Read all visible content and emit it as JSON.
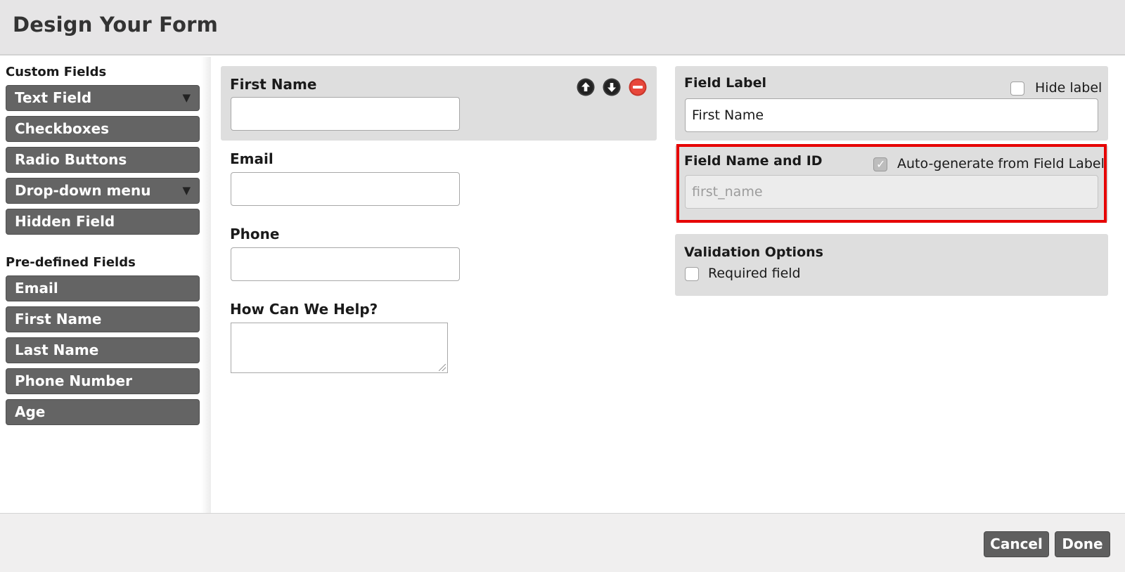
{
  "window": {
    "title": "Design Your Form"
  },
  "sidebar": {
    "custom_title": "Custom Fields",
    "custom_items": [
      {
        "label": "Text Field",
        "has_dropdown": true
      },
      {
        "label": "Checkboxes",
        "has_dropdown": false
      },
      {
        "label": "Radio Buttons",
        "has_dropdown": false
      },
      {
        "label": "Drop-down menu",
        "has_dropdown": true
      },
      {
        "label": "Hidden Field",
        "has_dropdown": false
      }
    ],
    "predefined_title": "Pre-defined Fields",
    "predefined_items": [
      {
        "label": "Email"
      },
      {
        "label": "First Name"
      },
      {
        "label": "Last Name"
      },
      {
        "label": "Phone Number"
      },
      {
        "label": "Age"
      }
    ],
    "caret": "▼"
  },
  "form": {
    "fields": [
      {
        "label": "First Name",
        "type": "text",
        "selected": true
      },
      {
        "label": "Email",
        "type": "text",
        "selected": false
      },
      {
        "label": "Phone",
        "type": "text",
        "selected": false
      },
      {
        "label": "How Can We Help?",
        "type": "textarea",
        "selected": false
      }
    ],
    "controls": {
      "move_up_icon": "arrow-up-circle",
      "move_down_icon": "arrow-down-circle",
      "remove_icon": "minus-circle"
    }
  },
  "properties": {
    "field_label": {
      "title": "Field Label",
      "hide_label_text": "Hide label",
      "hide_label_checked": false,
      "value": "First Name"
    },
    "field_name": {
      "title": "Field Name and ID",
      "autogen_text": "Auto-generate from Field Label",
      "autogen_checked": true,
      "value": "first_name"
    },
    "validation": {
      "title": "Validation Options",
      "required_text": "Required field",
      "required_checked": false
    }
  },
  "footer": {
    "cancel_label": "Cancel",
    "done_label": "Done"
  },
  "colors": {
    "button_bg": "#646464",
    "panel_bg": "#dedede",
    "highlight": "#e60000",
    "remove_red": "#e8473b"
  }
}
